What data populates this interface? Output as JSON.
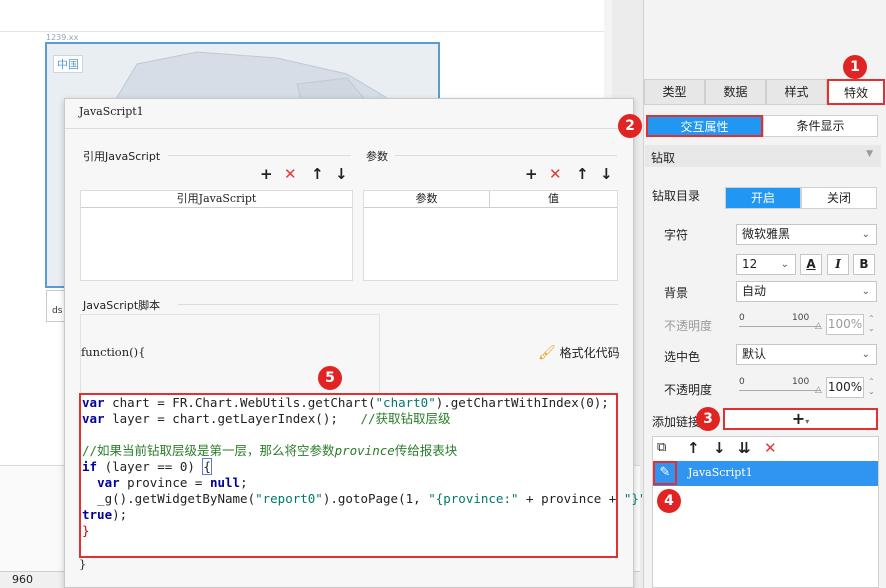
{
  "canvas": {
    "map_caption": "1239.xx",
    "map_title": "中国",
    "mini_label": "ds",
    "status_zoom": "960"
  },
  "dialog": {
    "title": "JavaScript1",
    "ref_section_label": "引用JavaScript",
    "ref_table_header": "引用JavaScript",
    "param_section_label": "参数",
    "param_table_headers": [
      "参数",
      "值"
    ],
    "script_section_label": "JavaScript脚本",
    "function_header": "function(){",
    "function_footer": "}",
    "format_button_label": "格式化代码",
    "code_lines": [
      "var chart = FR.Chart.WebUtils.getChart(\"chart0\").getChartWithIndex(0);",
      "var layer = chart.getLayerIndex();   //获取钻取层级",
      "",
      "//如果当前钻取层级是第一层，那么将空参数province传给报表块",
      "if (layer == 0) {",
      "  var province = null;",
      "  _g().getWidgetByName(\"report0\").gotoPage(1, \"{province:\" + province + \"}\",",
      "true);",
      "}"
    ]
  },
  "panel": {
    "tabs": [
      "类型",
      "数据",
      "样式",
      "特效"
    ],
    "active_tab": "特效",
    "sub_tabs": [
      "交互属性",
      "条件显示"
    ],
    "drill_header": "钻取",
    "drill_dir_label": "钻取目录",
    "drill_toggle": [
      "开启",
      "关闭"
    ],
    "font_label": "字符",
    "font_value": "微软雅黑",
    "font_size": "12",
    "style_buttons": [
      "A",
      "I",
      "B"
    ],
    "bg_label": "背景",
    "bg_value": "自动",
    "opacity_label": "不透明度",
    "opacity_scale": [
      "0",
      "100"
    ],
    "opacity_value": "100%",
    "selected_color_label": "选中色",
    "selected_color_value": "默认",
    "opacity2_label": "不透明度",
    "opacity2_scale": [
      "0",
      "100"
    ],
    "opacity2_value": "100%",
    "add_link_label": "添加链接",
    "link_items": [
      "JavaScript1"
    ]
  },
  "badges": [
    "1",
    "2",
    "3",
    "4",
    "5"
  ],
  "colors": {
    "accent_blue": "#2196f3",
    "highlight_red": "#e03030",
    "badge_red": "#e02424"
  }
}
